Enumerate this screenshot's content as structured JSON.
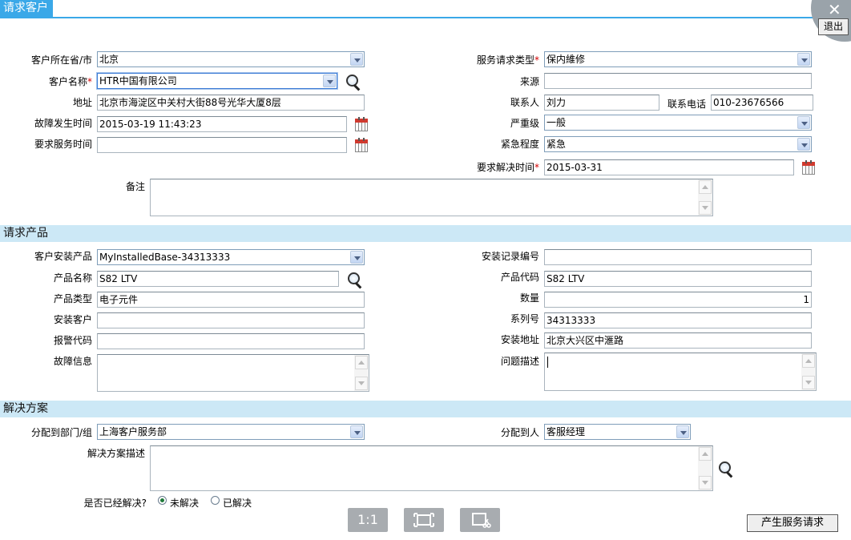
{
  "header": {
    "title": "请求客户",
    "exit_label": "退出",
    "close_glyph": "✕"
  },
  "customer": {
    "province_label": "客户所在省/市",
    "province_value": "北京",
    "name_label": "客户名称",
    "name_value": "HTR中国有限公司",
    "address_label": "地址",
    "address_value": "北京市海淀区中关村大街88号光华大厦8层",
    "fault_time_label": "故障发生时间",
    "fault_time_value": "2015-03-19 11:43:23",
    "req_service_time_label": "要求服务时间",
    "req_service_time_value": "",
    "service_type_label": "服务请求类型",
    "service_type_value": "保内維修",
    "source_label": "来源",
    "source_value": "",
    "contact_label": "联系人",
    "contact_value": "刘力",
    "phone_label": "联系电话",
    "phone_value": "010-23676566",
    "severity_label": "严重级",
    "severity_value": "一般",
    "urgency_label": "紧急程度",
    "urgency_value": "紧急",
    "resolve_time_label": "要求解决时间",
    "resolve_time_value": "2015-03-31",
    "remark_label": "备注",
    "required_mark": "*"
  },
  "product": {
    "section_title": "请求产品",
    "installed_label": "客户安装产品",
    "installed_value": "MyInstalledBase-34313333",
    "name_label": "产品名称",
    "name_value": "S82 LTV",
    "type_label": "产品类型",
    "type_value": "电子元件",
    "install_customer_label": "安装客户",
    "install_customer_value": "",
    "alarm_code_label": "报警代码",
    "alarm_code_value": "",
    "fault_info_label": "故障信息",
    "record_no_label": "安装记录编号",
    "record_no_value": "",
    "code_label": "产品代码",
    "code_value": "S82 LTV",
    "quantity_label": "数量",
    "quantity_value": "1",
    "serial_label": "系列号",
    "serial_value": "34313333",
    "install_addr_label": "安装地址",
    "install_addr_value": "北京大兴区中滙路",
    "issue_desc_label": "问题描述"
  },
  "solution": {
    "section_title": "解决方案",
    "dept_label": "分配到部门/组",
    "dept_value": "上海客户服务部",
    "assignee_label": "分配到人",
    "assignee_value": "客服经理",
    "desc_label": "解决方案描述",
    "resolved_label": "是否已经解决?",
    "option_unresolved": "未解决",
    "option_resolved": "已解决"
  },
  "toolbar": {
    "btn_1_1": "1:1"
  },
  "footer": {
    "generate_label": "产生服务请求"
  },
  "colors": {
    "accent": "#3aa8e8",
    "section_bg": "#cce8f6",
    "required": "#d40000"
  }
}
